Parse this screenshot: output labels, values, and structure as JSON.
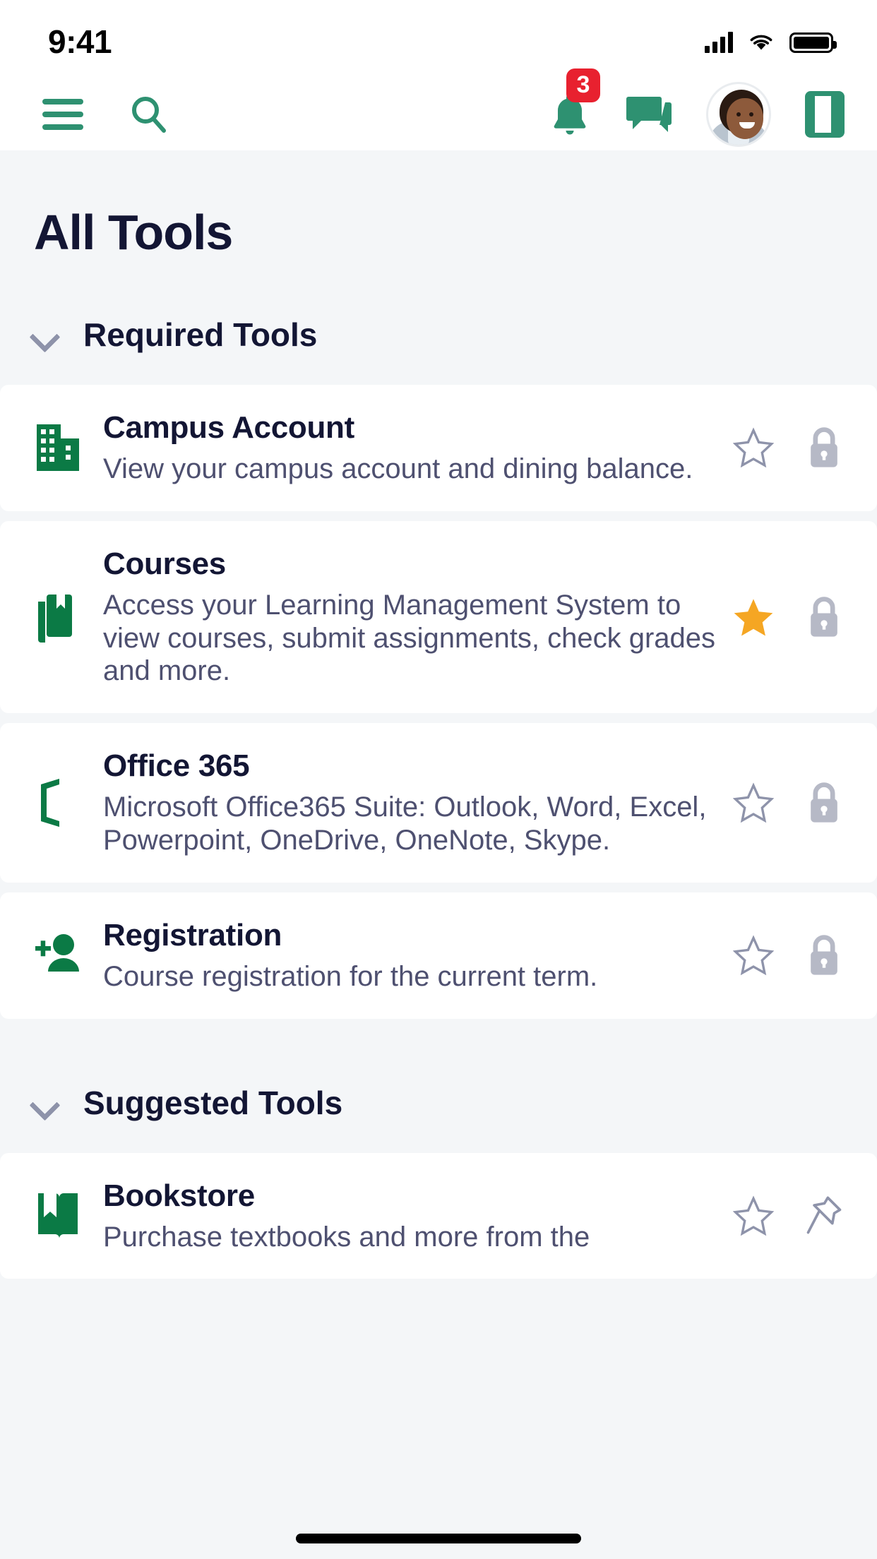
{
  "status_bar": {
    "time": "9:41",
    "signal_icon": "cellular-signal-icon",
    "wifi_icon": "wifi-icon",
    "battery_icon": "battery-full-icon"
  },
  "nav_bar": {
    "menu_icon": "hamburger-menu-icon",
    "search_icon": "search-icon",
    "notifications_icon": "bell-icon",
    "notifications_badge": "3",
    "messages_icon": "chat-bubbles-icon",
    "avatar_icon": "user-avatar",
    "book_icon": "book-panel-icon"
  },
  "page": {
    "title": "All Tools"
  },
  "colors": {
    "brand_green": "#2e9171",
    "badge_red": "#e8212f",
    "star_gold": "#f5a623",
    "title_navy": "#131634",
    "body_text": "#4e5070",
    "page_bg": "#f4f6f8",
    "card_bg": "#ffffff",
    "muted_gray": "#b6b9c6"
  },
  "sections": [
    {
      "label": "Required Tools",
      "chevron_icon": "chevron-down-icon",
      "tools": [
        {
          "name": "Campus Account",
          "description": "View your campus account and dining balance.",
          "icon": "building-icon",
          "favorite": false,
          "favorite_icon": "star-outline-icon",
          "lock_icon": "lock-icon"
        },
        {
          "name": "Courses",
          "description": "Access your Learning Management System to view courses, submit assignments, check grades and more.",
          "icon": "book-bookmark-icon",
          "favorite": true,
          "favorite_icon": "star-filled-icon",
          "lock_icon": "lock-icon"
        },
        {
          "name": "Office 365",
          "description": "Microsoft Office365 Suite: Outlook, Word, Excel, Powerpoint, OneDrive, OneNote, Skype.",
          "icon": "office-door-icon",
          "favorite": false,
          "favorite_icon": "star-outline-icon",
          "lock_icon": "lock-icon"
        },
        {
          "name": "Registration",
          "description": "Course registration for the current term.",
          "icon": "person-add-icon",
          "favorite": false,
          "favorite_icon": "star-outline-icon",
          "lock_icon": "lock-icon"
        }
      ]
    },
    {
      "label": "Suggested Tools",
      "chevron_icon": "chevron-down-icon",
      "tools": [
        {
          "name": "Bookstore",
          "description": "Purchase textbooks and more from the",
          "icon": "open-book-icon",
          "favorite": false,
          "favorite_icon": "star-outline-icon",
          "lock_icon": "pin-icon"
        }
      ]
    }
  ]
}
